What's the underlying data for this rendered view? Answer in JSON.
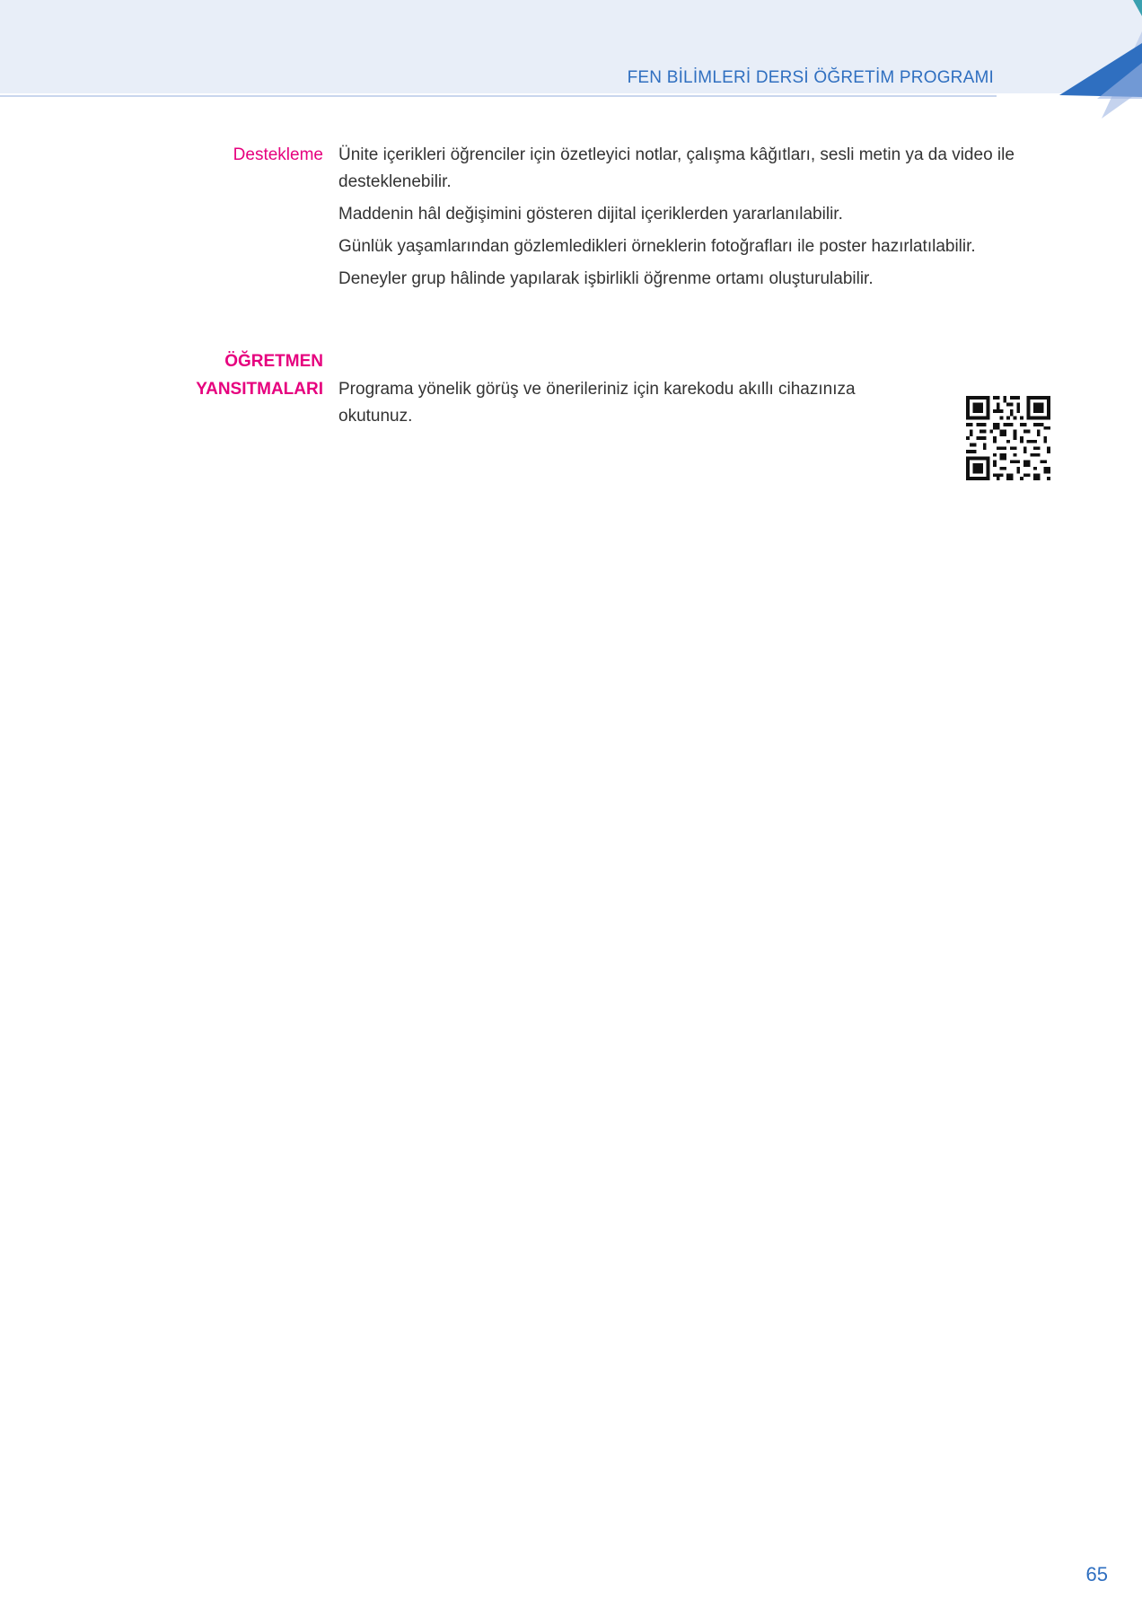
{
  "header": {
    "title": "FEN BİLİMLERİ DERSİ ÖĞRETİM PROGRAMI",
    "band_color": "#e8eef8",
    "accent_color": "#2f6fc0"
  },
  "sections": {
    "destekleme": {
      "label": "Destekleme",
      "paragraphs": [
        "Ünite içerikleri öğrenciler için  özetleyici notlar, çalışma kâğıtları, sesli metin ya da video ile desteklenebilir.",
        "Maddenin hâl değişimini gösteren dijital içeriklerden yararlanılabilir.",
        "Günlük yaşamlarından gözlemledikleri örneklerin fotoğrafları ile poster hazırlatılabilir.",
        "Deneyler grup hâlinde yapılarak işbirlikli öğrenme ortamı oluşturulabilir."
      ]
    },
    "ogretmen": {
      "label_line1": "ÖĞRETMEN",
      "label_line2": "YANSITMALARI",
      "text": "Programa yönelik görüş ve önerileriniz için karekodu akıllı cihazınıza okutunuz."
    }
  },
  "label_color": "#e6007e",
  "qr_icon": "qr-code-icon",
  "page_number": "65"
}
